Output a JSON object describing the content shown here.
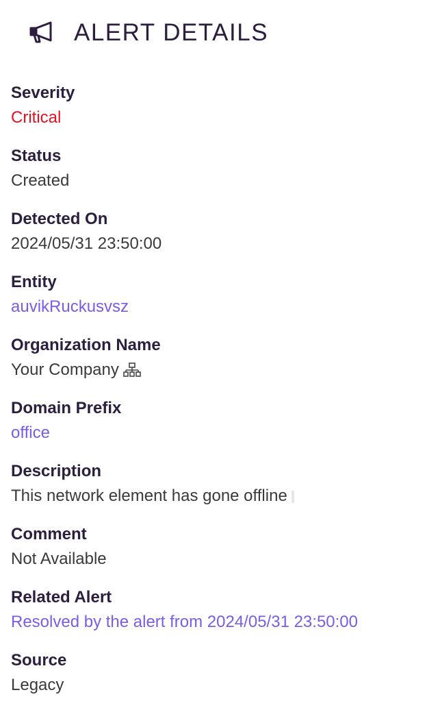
{
  "header": {
    "title": "ALERT DETAILS",
    "icon": "megaphone-icon"
  },
  "fields": [
    {
      "label": "Severity",
      "value": "Critical",
      "style": "critical",
      "color": "#e8101e"
    },
    {
      "label": "Status",
      "value": "Created",
      "style": "text"
    },
    {
      "label": "Detected On",
      "value": "2024/05/31 23:50:00",
      "style": "text"
    },
    {
      "label": "Entity",
      "value": "auvikRuckusvsz",
      "style": "link",
      "color": "#7b5ce6"
    },
    {
      "label": "Organization Name",
      "value": "Your Company",
      "style": "text",
      "icon": "org-hierarchy-icon"
    },
    {
      "label": "Domain Prefix",
      "value": "office",
      "style": "link",
      "color": "#7b5ce6"
    },
    {
      "label": "Description",
      "value": "This network element has gone offline",
      "style": "text"
    },
    {
      "label": "Comment",
      "value": "Not Available",
      "style": "text"
    },
    {
      "label": "Related Alert",
      "value": "Resolved by the alert from 2024/05/31 23:50:00",
      "style": "link",
      "color": "#7b5ce6"
    },
    {
      "label": "Source",
      "value": "Legacy",
      "style": "text"
    }
  ]
}
